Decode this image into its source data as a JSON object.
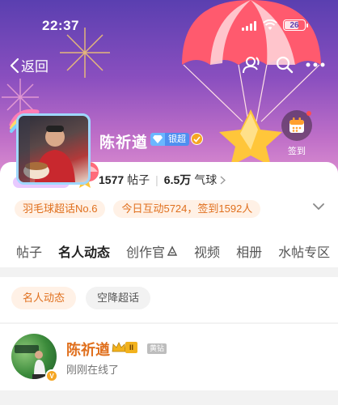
{
  "status_bar": {
    "time": "22:37",
    "battery": "26"
  },
  "nav": {
    "back_label": "返回"
  },
  "profile": {
    "name": "陈祈遒",
    "silver_badge": "银超",
    "checkin_label": "签到"
  },
  "stats": {
    "posts_count": "1577",
    "posts_label": "帖子",
    "balloons_count": "6.5万",
    "balloons_label": "气球"
  },
  "chips": [
    {
      "label": "羽毛球超话No.6"
    },
    {
      "label": "今日互动5724，签到1592人"
    }
  ],
  "tabs": [
    {
      "label": "帖子"
    },
    {
      "label": "名人动态",
      "active": true
    },
    {
      "label": "创作官"
    },
    {
      "label": "视频"
    },
    {
      "label": "相册"
    },
    {
      "label": "水帖专区"
    }
  ],
  "subtabs": [
    {
      "label": "名人动态",
      "active": true
    },
    {
      "label": "空降超话"
    }
  ],
  "post": {
    "name": "陈祈遒",
    "level": "II",
    "tag": "黄钻",
    "status": "刚刚在线了"
  },
  "colors": {
    "accent": "#ff8200",
    "chip_text": "#e0701e",
    "chip_bg": "#fff1e6"
  }
}
